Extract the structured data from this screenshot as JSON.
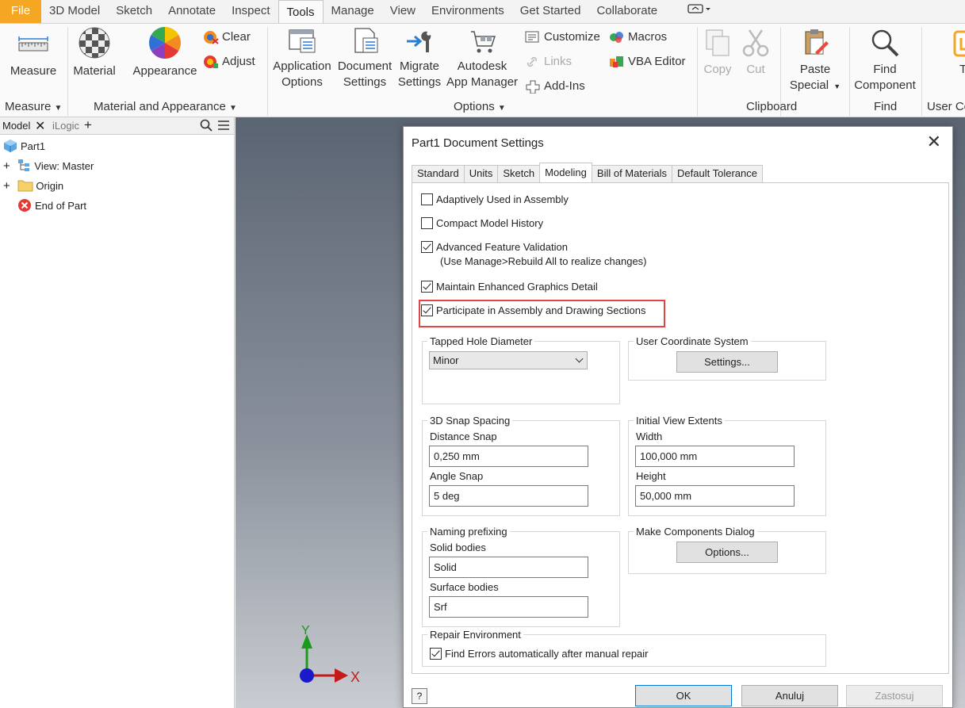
{
  "menu": {
    "tabs": [
      "File",
      "3D Model",
      "Sketch",
      "Annotate",
      "Inspect",
      "Tools",
      "Manage",
      "View",
      "Environments",
      "Get Started",
      "Collaborate"
    ],
    "active": "Tools"
  },
  "ribbon": {
    "measure": {
      "label": "Measure"
    },
    "material": {
      "label": "Material"
    },
    "appearance": {
      "label": "Appearance"
    },
    "clear": {
      "label": "Clear"
    },
    "adjust": {
      "label": "Adjust"
    },
    "app_options": {
      "line1": "Application",
      "line2": "Options"
    },
    "doc_settings": {
      "line1": "Document",
      "line2": "Settings"
    },
    "migrate": {
      "line1": "Migrate",
      "line2": "Settings"
    },
    "autodesk": {
      "line1": "Autodesk",
      "line2": "App Manager"
    },
    "customize": {
      "label": "Customize"
    },
    "links": {
      "label": "Links"
    },
    "addins": {
      "label": "Add-Ins"
    },
    "macros": {
      "label": "Macros"
    },
    "vba": {
      "label": "VBA Editor"
    },
    "copy": {
      "label": "Copy"
    },
    "cut": {
      "label": "Cut"
    },
    "paste_special": {
      "line1": "Paste",
      "line2": "Special"
    },
    "find_component": {
      "line1": "Find",
      "line2": "Component"
    },
    "truncated": {
      "label": "T"
    },
    "groups": {
      "measure": "Measure",
      "material_appearance": "Material and Appearance",
      "options": "Options",
      "clipboard": "Clipboard",
      "find": "Find",
      "user_co": "User Co"
    }
  },
  "browser": {
    "tabs": {
      "model": "Model",
      "ilogic": "iLogic"
    },
    "tree": [
      {
        "label": "Part1"
      },
      {
        "label": "View: Master"
      },
      {
        "label": "Origin"
      },
      {
        "label": "End of Part"
      }
    ]
  },
  "dialog": {
    "title": "Part1 Document Settings",
    "tabs": [
      "Standard",
      "Units",
      "Sketch",
      "Modeling",
      "Bill of Materials",
      "Default Tolerance"
    ],
    "active_tab": "Modeling",
    "checkboxes": {
      "adaptively": {
        "label": "Adaptively Used in Assembly",
        "checked": false
      },
      "compact": {
        "label": "Compact Model History",
        "checked": false
      },
      "advanced": {
        "label": "Advanced Feature Validation",
        "checked": true,
        "note": "(Use Manage>Rebuild All to realize changes)"
      },
      "enhanced": {
        "label": "Maintain Enhanced Graphics Detail",
        "checked": true
      },
      "participate": {
        "label": "Participate in Assembly and Drawing Sections",
        "checked": true
      }
    },
    "tapped": {
      "legend": "Tapped Hole Diameter",
      "value": "Minor"
    },
    "ucs": {
      "legend": "User Coordinate System",
      "button": "Settings..."
    },
    "snap": {
      "legend": "3D Snap Spacing",
      "distance_label": "Distance Snap",
      "distance_value": "0,250 mm",
      "angle_label": "Angle Snap",
      "angle_value": "5 deg"
    },
    "view_extents": {
      "legend": "Initial View Extents",
      "width_label": "Width",
      "width_value": "100,000 mm",
      "height_label": "Height",
      "height_value": "50,000 mm"
    },
    "naming": {
      "legend": "Naming prefixing",
      "solid_label": "Solid bodies",
      "solid_value": "Solid",
      "surface_label": "Surface bodies",
      "surface_value": "Srf"
    },
    "make_components": {
      "legend": "Make Components Dialog",
      "button": "Options..."
    },
    "repair": {
      "legend": "Repair Environment",
      "label": "Find Errors automatically after manual repair",
      "checked": true
    },
    "buttons": {
      "help": "?",
      "ok": "OK",
      "cancel": "Anuluj",
      "apply": "Zastosuj"
    }
  },
  "triad": {
    "y": "Y",
    "x": "X"
  },
  "colors": {
    "accent_file": "#f5a623",
    "highlight": "#e04646",
    "primary_border": "#0078d7"
  }
}
